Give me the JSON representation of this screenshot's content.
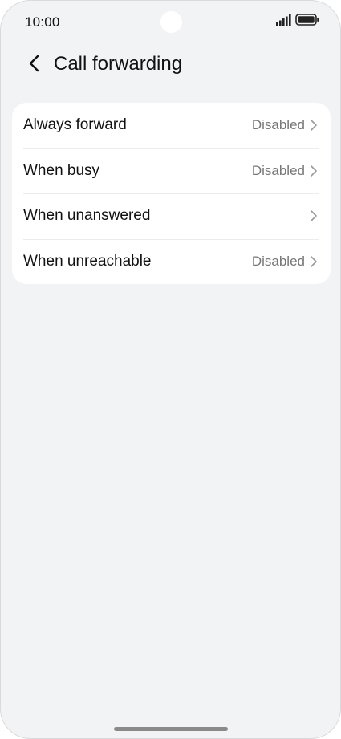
{
  "status_bar": {
    "time": "10:00",
    "icons": [
      "signal-icon",
      "battery-icon"
    ]
  },
  "header": {
    "back_icon": "chevron-left-icon",
    "title": "Call forwarding"
  },
  "settings": {
    "items": [
      {
        "label": "Always forward",
        "value": "Disabled"
      },
      {
        "label": "When busy",
        "value": "Disabled"
      },
      {
        "label": "When unanswered",
        "value": ""
      },
      {
        "label": "When unreachable",
        "value": "Disabled"
      }
    ]
  },
  "colors": {
    "background": "#f2f3f5",
    "card": "#ffffff",
    "text": "#111111",
    "secondary_text": "#777777"
  }
}
